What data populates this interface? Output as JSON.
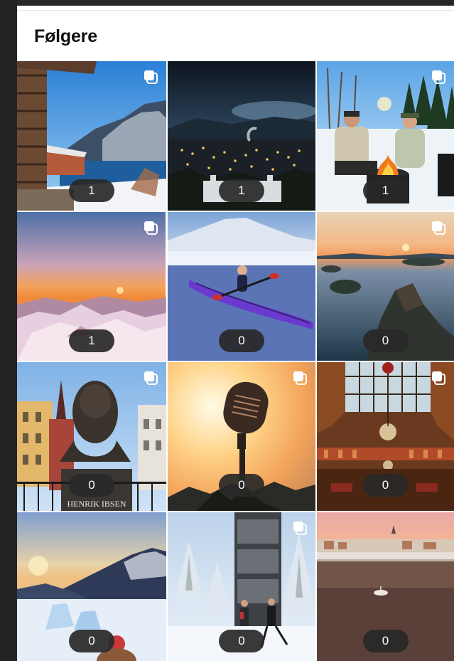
{
  "header": {
    "title": "Følgere"
  },
  "tiles": [
    {
      "count": "1",
      "multi": true
    },
    {
      "count": "1",
      "multi": false
    },
    {
      "count": "1",
      "multi": true
    },
    {
      "count": "1",
      "multi": true
    },
    {
      "count": "0",
      "multi": false
    },
    {
      "count": "0",
      "multi": true
    },
    {
      "count": "0",
      "multi": true
    },
    {
      "count": "0",
      "multi": true
    },
    {
      "count": "0",
      "multi": true
    },
    {
      "count": "0",
      "multi": false
    },
    {
      "count": "0",
      "multi": true
    },
    {
      "count": "0",
      "multi": false
    }
  ],
  "photo_texts": {
    "statue_plaque": "HENRIK IBSEN"
  },
  "icons": {
    "multi": "carousel-icon"
  }
}
